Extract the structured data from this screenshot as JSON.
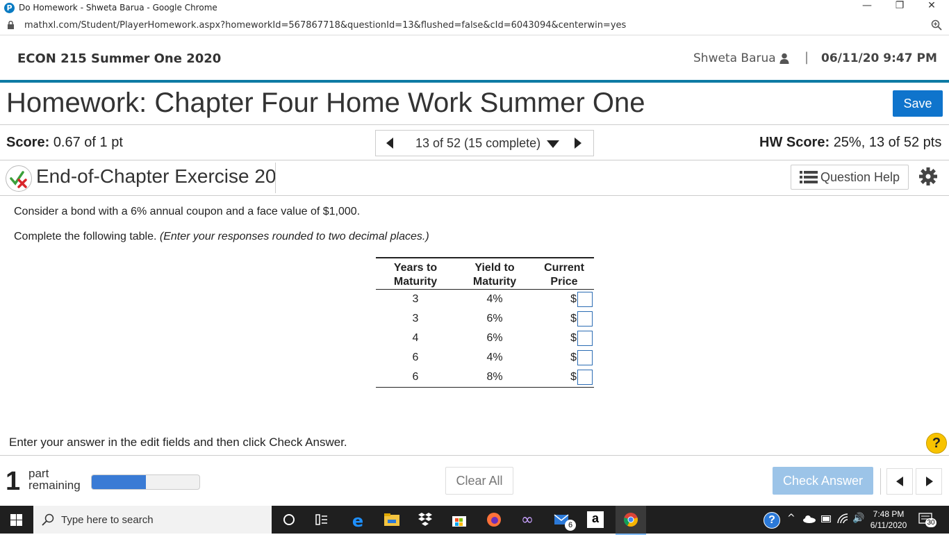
{
  "browser": {
    "window_title": "Do Homework - Shweta Barua - Google Chrome",
    "url": "mathxl.com/Student/PlayerHomework.aspx?homeworkId=567867718&questionId=13&flushed=false&cId=6043094&centerwin=yes",
    "minimize": "—",
    "restore": "❐",
    "close": "✕"
  },
  "header": {
    "course": "ECON 215 Summer One 2020",
    "user": "Shweta Barua",
    "separator": "|",
    "datetime": "06/11/20 9:47 PM"
  },
  "homework": {
    "title": "Homework: Chapter Four Home Work Summer One",
    "save_label": "Save",
    "score_label": "Score:",
    "score_value": "0.67 of 1 pt",
    "question_nav": "13 of 52 (15 complete)",
    "hw_score_label": "HW Score:",
    "hw_score_value": "25%, 13 of 52 pts"
  },
  "exercise": {
    "title": "End-of-Chapter Exercise 20",
    "question_help": "Question Help",
    "intro": "Consider a bond with a 6% annual coupon and a face value of $1,000.",
    "instruction_plain": "Complete the following table.",
    "instruction_italic": "(Enter your responses rounded to two decimal places.)"
  },
  "table": {
    "headers": [
      {
        "line1": "Years to",
        "line2": "Maturity"
      },
      {
        "line1": "Yield to",
        "line2": "Maturity"
      },
      {
        "line1": "Current",
        "line2": "Price"
      }
    ],
    "currency": "$",
    "rows": [
      {
        "years": "3",
        "yield": "4%",
        "price": ""
      },
      {
        "years": "3",
        "yield": "6%",
        "price": ""
      },
      {
        "years": "4",
        "yield": "6%",
        "price": ""
      },
      {
        "years": "6",
        "yield": "4%",
        "price": ""
      },
      {
        "years": "6",
        "yield": "8%",
        "price": ""
      }
    ]
  },
  "footer": {
    "enter_answer": "Enter your answer in the edit fields and then click Check Answer.",
    "help_symbol": "?",
    "parts_count": "1",
    "part_word": "part",
    "remaining_word": "remaining",
    "progress_fraction": 0.5,
    "clear_all": "Clear All",
    "check_answer": "Check Answer"
  },
  "taskbar": {
    "search_placeholder": "Type here to search",
    "mail_badge": "6",
    "time": "7:48 PM",
    "date": "6/11/2020",
    "notifications": "30"
  },
  "colors": {
    "accent": "#0e7ba4",
    "save_button": "#0f74cc",
    "check_answer": "#9cc4e8",
    "progress_fill": "#3a7bd5",
    "input_border": "#2b6cb3"
  }
}
